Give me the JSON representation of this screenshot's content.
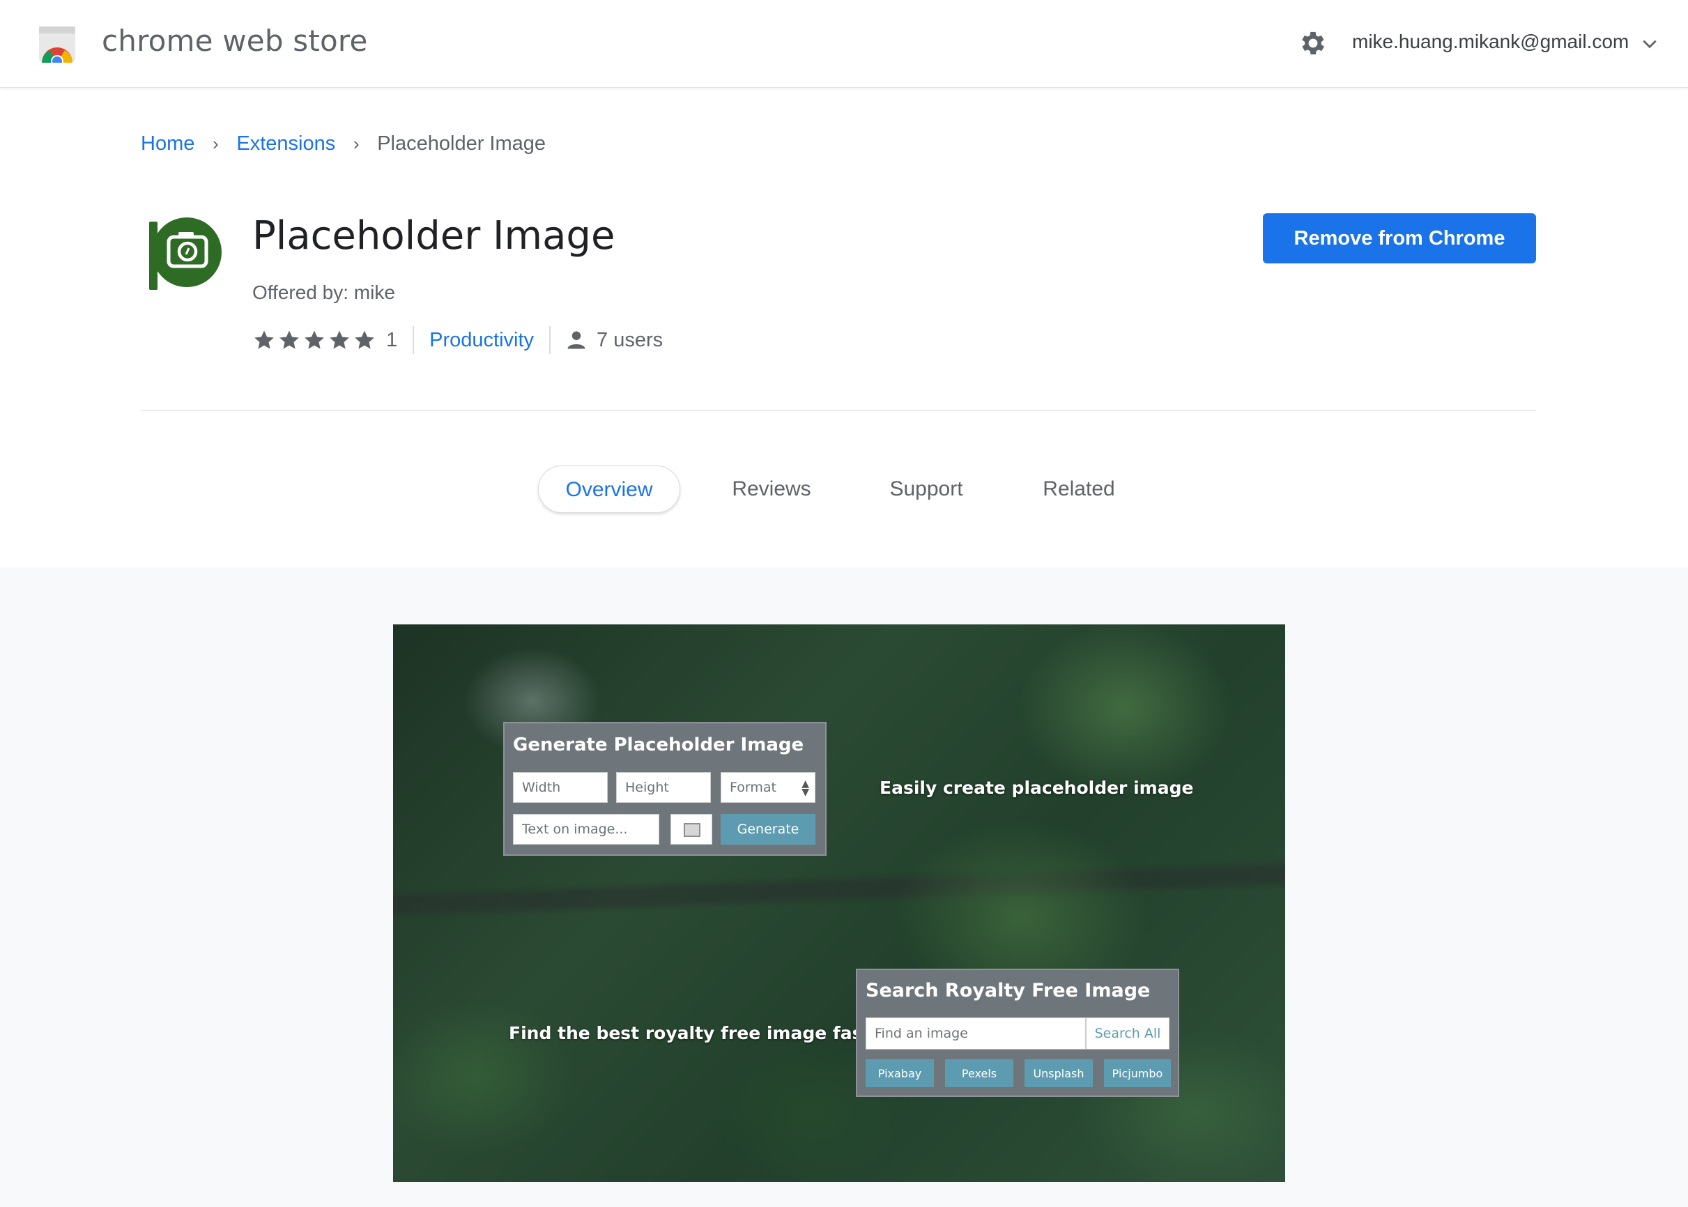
{
  "header": {
    "store_title": "chrome web store",
    "account_email": "mike.huang.mikank@gmail.com",
    "icons": [
      "chrome-web-store-logo-icon",
      "gear-icon",
      "chevron-down-icon"
    ]
  },
  "breadcrumb": {
    "home": "Home",
    "extensions": "Extensions",
    "current": "Placeholder Image",
    "separator": "›"
  },
  "extension": {
    "title": "Placeholder Image",
    "offered_by": "Offered by: mike",
    "rating_stars": 5,
    "rating_count": "1",
    "category": "Productivity",
    "users": "7 users",
    "icon_color": "#2e6b25"
  },
  "action_button": {
    "label": "Remove from Chrome",
    "color": "#1a73e8"
  },
  "tabs": [
    {
      "label": "Overview",
      "active": true
    },
    {
      "label": "Reviews",
      "active": false
    },
    {
      "label": "Support",
      "active": false
    },
    {
      "label": "Related",
      "active": false
    }
  ],
  "screenshot": {
    "generate_panel": {
      "title": "Generate Placeholder Image",
      "width_placeholder": "Width",
      "height_placeholder": "Height",
      "format_label": "Format",
      "text_placeholder": "Text on image...",
      "generate_label": "Generate"
    },
    "caption_top": "Easily create placeholder image",
    "caption_bottom": "Find the best royalty free image fast",
    "search_panel": {
      "title": "Search Royalty Free Image",
      "input_placeholder": "Find an image",
      "search_all_label": "Search All",
      "sources": [
        "Pixabay",
        "Pexels",
        "Unsplash",
        "Picjumbo"
      ]
    },
    "accent_color": "#5d9bb0"
  }
}
